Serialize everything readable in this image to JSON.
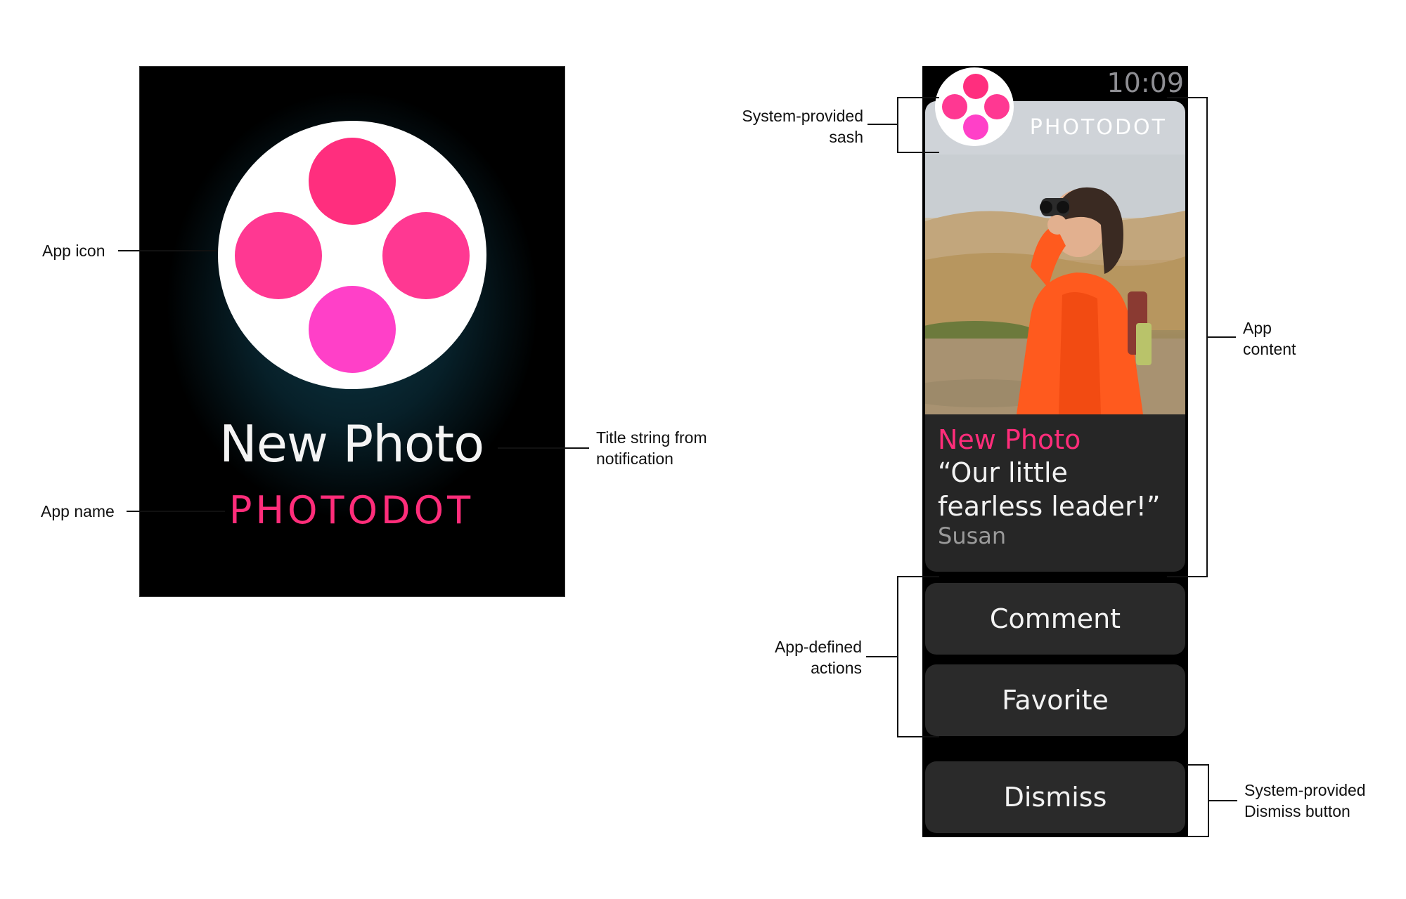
{
  "short_look": {
    "title": "New Photo",
    "app_name": "PHOTODOT"
  },
  "long_look": {
    "time": "10:09",
    "sash_app_name": "PHOTODOT",
    "notification_title": "New Photo",
    "message": "“Our little fearless leader!”",
    "sender": "Susan",
    "actions": [
      "Comment",
      "Favorite"
    ],
    "dismiss": "Dismiss"
  },
  "callouts": {
    "app_icon": "App icon",
    "app_name": "App name",
    "title_string": [
      "Title string from",
      "notification"
    ],
    "sash": [
      "System-provided",
      "sash"
    ],
    "app_content": [
      "App",
      "content"
    ],
    "app_actions": [
      "App-defined",
      "actions"
    ],
    "dismiss_button": [
      "System-provided",
      "Dismiss button"
    ]
  },
  "colors": {
    "accent_pink": "#ff2d7a",
    "icon_dot_top": "#ff2e7e",
    "icon_dot_side": "#ff3892",
    "icon_dot_bottom": "#ff40c8",
    "watch_background": "#000000",
    "button_background": "#2a2a2a"
  }
}
